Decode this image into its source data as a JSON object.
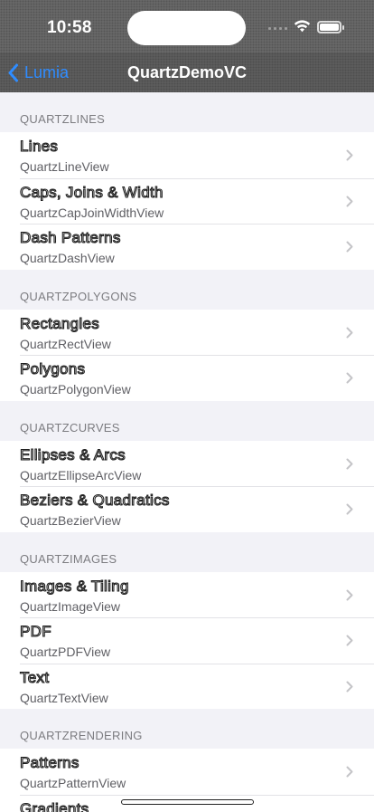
{
  "status_bar": {
    "time": "10:58"
  },
  "nav": {
    "back_label": "Lumia",
    "title": "QuartzDemoVC"
  },
  "sections": [
    {
      "header": "QUARTZLINES",
      "items": [
        {
          "title": "Lines",
          "subtitle": "QuartzLineView"
        },
        {
          "title": "Caps, Joins & Width",
          "subtitle": "QuartzCapJoinWidthView"
        },
        {
          "title": "Dash Patterns",
          "subtitle": "QuartzDashView"
        }
      ]
    },
    {
      "header": "QUARTZPOLYGONS",
      "items": [
        {
          "title": "Rectangles",
          "subtitle": "QuartzRectView"
        },
        {
          "title": "Polygons",
          "subtitle": "QuartzPolygonView"
        }
      ]
    },
    {
      "header": "QUARTZCURVES",
      "items": [
        {
          "title": "Ellipses & Arcs",
          "subtitle": "QuartzEllipseArcView"
        },
        {
          "title": "Beziers & Quadratics",
          "subtitle": "QuartzBezierView"
        }
      ]
    },
    {
      "header": "QUARTZIMAGES",
      "items": [
        {
          "title": "Images & Tiling",
          "subtitle": "QuartzImageView"
        },
        {
          "title": "PDF",
          "subtitle": "QuartzPDFView"
        },
        {
          "title": "Text",
          "subtitle": "QuartzTextView"
        }
      ]
    },
    {
      "header": "QUARTZRENDERING",
      "items": [
        {
          "title": "Patterns",
          "subtitle": "QuartzPatternView"
        },
        {
          "title": "Gradients",
          "subtitle": ""
        }
      ]
    }
  ],
  "colors": {
    "tint": "#2f8cff",
    "background": "#f2f2f7"
  },
  "icons": {
    "back": "chevron-left-icon",
    "disclosure": "chevron-right-icon"
  }
}
